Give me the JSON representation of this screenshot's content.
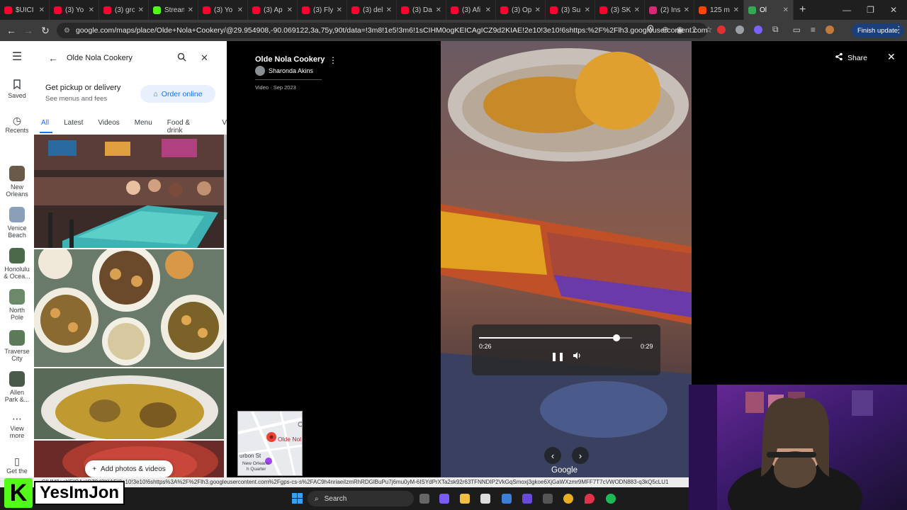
{
  "browser": {
    "tabs": [
      {
        "title": "$UICI",
        "color": "#ff0033"
      },
      {
        "title": "(3) Yo",
        "color": "#ff0033"
      },
      {
        "title": "(3) gro",
        "color": "#ff0033"
      },
      {
        "title": "Stream",
        "color": "#53fc18"
      },
      {
        "title": "(3) Yo",
        "color": "#ff0033"
      },
      {
        "title": "(3) Ap",
        "color": "#ff0033"
      },
      {
        "title": "(3) Fly",
        "color": "#ff0033"
      },
      {
        "title": "(3) del",
        "color": "#ff0033"
      },
      {
        "title": "(3) Da",
        "color": "#ff0033"
      },
      {
        "title": "(3) Afi",
        "color": "#ff0033"
      },
      {
        "title": "(3) Op",
        "color": "#ff0033"
      },
      {
        "title": "(3) Su",
        "color": "#ff0033"
      },
      {
        "title": "(3) SK",
        "color": "#ff0033"
      },
      {
        "title": "(2) Ins",
        "color": "#d62976"
      },
      {
        "title": "125 m",
        "color": "#ff4500"
      },
      {
        "title": "Ol",
        "color": "#34a853",
        "active": true
      }
    ],
    "new_tab": "+",
    "url": "google.com/maps/place/Olde+Nola+Cookery/@29.954908,-90.069122,3a,75y,90t/data=!3m8!1e5!3m6!1sCIHM0ogKEICAgICZ9d2KIAE!2e10!3e10!6shttps:%2F%2Flh3.googleusercontent.com%2F...",
    "finish_update": "Finish update",
    "status_url": "...CIHM0ogKEICAgICZ9d2KIAE!2e10!3e10!6shttps%3A%2F%2Flh3.googleusercontent.com%2Fgps-cs-s%2FAC9h4nriaeiIzmRhRDGlBuPu7j6mu0yM-6ISYdPrXTa2sk92r63TFNNDIP2VkGqSmoxj3gkoe6XjGaWXzmr9MFF7T7cVWODN883-q3kQ5cLU1"
  },
  "rail": {
    "saved": "Saved",
    "recents": "Recents",
    "recent_items": [
      {
        "label1": "New",
        "label2": "Orleans",
        "color": "#6a5a4a"
      },
      {
        "label1": "Venice",
        "label2": "Beach",
        "color": "#8aa0b8"
      },
      {
        "label1": "Honolulu",
        "label2": "& Ocea...",
        "color": "#4a6a4a"
      },
      {
        "label1": "North",
        "label2": "Pole",
        "color": "#6a8a6a"
      },
      {
        "label1": "Traverse",
        "label2": "City",
        "color": "#5a7a5a"
      },
      {
        "label1": "Allen",
        "label2": "Park &...",
        "color": "#4a5a4a"
      }
    ],
    "view_more": "View",
    "view_more2": "more",
    "get_app": "Get the"
  },
  "panel": {
    "search_value": "Olde Nola Cookery",
    "pickup_heading": "Get pickup or delivery",
    "pickup_sub": "See menus and fees",
    "order_online": "Order online",
    "filters": [
      "All",
      "Latest",
      "Videos",
      "Menu",
      "Food & drink",
      "V"
    ],
    "add_photos": "Add photos & videos"
  },
  "viewer": {
    "place_name": "Olde Nola Cookery",
    "author": "Sharonda Akins",
    "date": "Video · Sep 2023",
    "share": "Share",
    "time_current": "0:26",
    "time_total": "0:29",
    "progress_fraction": 0.897,
    "google_label": "Google",
    "minimap": {
      "place_label": "Olde Nol",
      "street": "urbon St",
      "district1": "New Orleans",
      "district2": "h Quarter"
    }
  },
  "taskbar": {
    "search": "Search"
  },
  "watermark": {
    "k": "K",
    "name": "YesImJon"
  }
}
